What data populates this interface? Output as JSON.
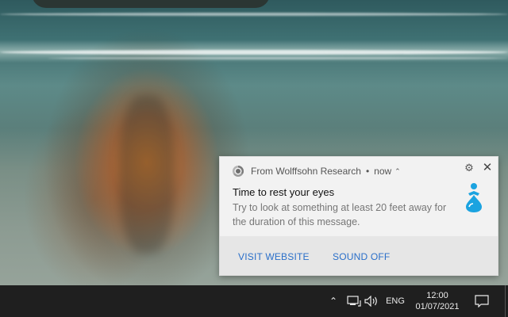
{
  "notification": {
    "source": "From Wolffsohn Research",
    "separator": "•",
    "time": "now",
    "title": "Time to rest your eyes",
    "body": "Try to look at something at least 20 feet away for the duration of this message.",
    "actions": [
      {
        "label": "VISIT WEBSITE"
      },
      {
        "label": "SOUND OFF"
      }
    ],
    "icons": {
      "browser": "chrome-icon",
      "settings": "gear-icon",
      "close": "close-icon",
      "app": "water-drop-person-icon"
    },
    "accent_color": "#2a6fc9",
    "logo_color": "#1ba3e0"
  },
  "taskbar": {
    "language": "ENG",
    "time": "12:00",
    "date": "01/07/2021",
    "icons": [
      "chevron-up-icon",
      "network-icon",
      "volume-icon",
      "notification-center-icon"
    ]
  }
}
